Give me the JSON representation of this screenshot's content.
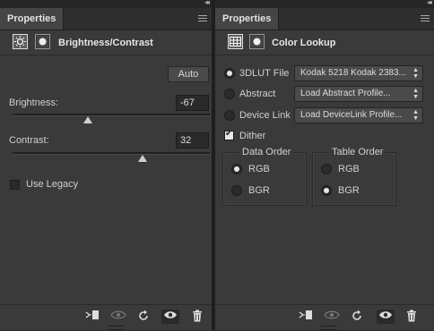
{
  "left": {
    "tab_title": "Properties",
    "header_title": "Brightness/Contrast",
    "auto_label": "Auto",
    "brightness": {
      "label": "Brightness:",
      "value": "-67",
      "slider_fraction": 0.38
    },
    "contrast": {
      "label": "Contrast:",
      "value": "32",
      "slider_fraction": 0.66
    },
    "use_legacy": {
      "label": "Use Legacy",
      "checked": false
    },
    "footer_icons": [
      "clip-to-layer-icon",
      "view-previous-state-icon",
      "reset-icon",
      "visibility-icon",
      "delete-icon"
    ]
  },
  "right": {
    "tab_title": "Properties",
    "header_title": "Color Lookup",
    "options": [
      {
        "label": "3DLUT File",
        "selected": true,
        "dropdown": "Kodak  5218  Kodak  2383..."
      },
      {
        "label": "Abstract",
        "selected": false,
        "dropdown": "Load Abstract Profile..."
      },
      {
        "label": "Device Link",
        "selected": false,
        "dropdown": "Load DeviceLink Profile..."
      }
    ],
    "dither": {
      "label": "Dither",
      "checked": true
    },
    "data_order": {
      "title": "Data Order",
      "options": [
        "RGB",
        "BGR"
      ],
      "selected": "RGB"
    },
    "table_order": {
      "title": "Table Order",
      "options": [
        "RGB",
        "BGR"
      ],
      "selected": "BGR"
    },
    "footer_icons": [
      "clip-to-layer-icon",
      "view-previous-state-icon",
      "reset-icon",
      "visibility-icon",
      "delete-icon"
    ]
  }
}
